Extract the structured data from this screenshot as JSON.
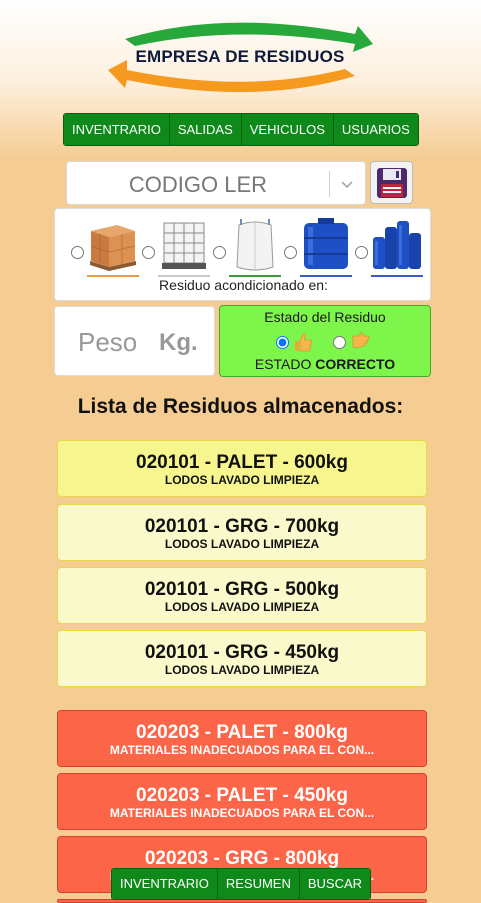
{
  "header": {
    "logo_text": "EMPRESA DE RESIDUOS"
  },
  "nav": {
    "items": [
      "INVENTRARIO",
      "SALIDAS",
      "VEHICULOS",
      "USUARIOS"
    ]
  },
  "form": {
    "codigo_placeholder": "CODIGO LER",
    "containers": [
      {
        "name": "palet",
        "selected": false
      },
      {
        "name": "grg",
        "selected": false
      },
      {
        "name": "big-bag",
        "selected": false
      },
      {
        "name": "bidon",
        "selected": false
      },
      {
        "name": "bidones",
        "selected": false
      }
    ],
    "container_caption": "Residuo acondicionado en:",
    "peso_label": "Peso",
    "peso_unit": "Kg.",
    "estado_title": "Estado del Residuo",
    "estado_prefix": "ESTADO",
    "estado_value": "CORRECTO",
    "estado_selected": "correcto"
  },
  "list": {
    "title": "Lista de Residuos almacenados:",
    "items": [
      {
        "title": "020101 - PALET - 600kg",
        "subtitle": "LODOS LAVADO LIMPIEZA",
        "color": "yellow"
      },
      {
        "title": "020101 - GRG - 700kg",
        "subtitle": "LODOS LAVADO LIMPIEZA",
        "color": "yellow"
      },
      {
        "title": "020101 - GRG - 500kg",
        "subtitle": "LODOS LAVADO LIMPIEZA",
        "color": "yellow"
      },
      {
        "title": "020101 - GRG - 450kg",
        "subtitle": "LODOS LAVADO LIMPIEZA",
        "color": "yellow"
      },
      {
        "title": "020203 - PALET - 800kg",
        "subtitle": "MATERIALES INADECUADOS PARA EL CON...",
        "color": "red"
      },
      {
        "title": "020203 - PALET - 450kg",
        "subtitle": "MATERIALES INADECUADOS PARA EL CON...",
        "color": "red"
      },
      {
        "title": "020203 - GRG - 800kg",
        "subtitle": "MATERIALES INADECUADOS PARA EL CON...",
        "color": "red"
      }
    ]
  },
  "bottom_nav": {
    "items": [
      "INVENTRARIO",
      "RESUMEN",
      "BUSCAR"
    ]
  },
  "colors": {
    "nav_green": "#0f8a1a",
    "estado_green": "#7ef54a",
    "card_yellow": "#faf9cc",
    "card_red": "#fd6548",
    "background": "#f5cc92"
  }
}
